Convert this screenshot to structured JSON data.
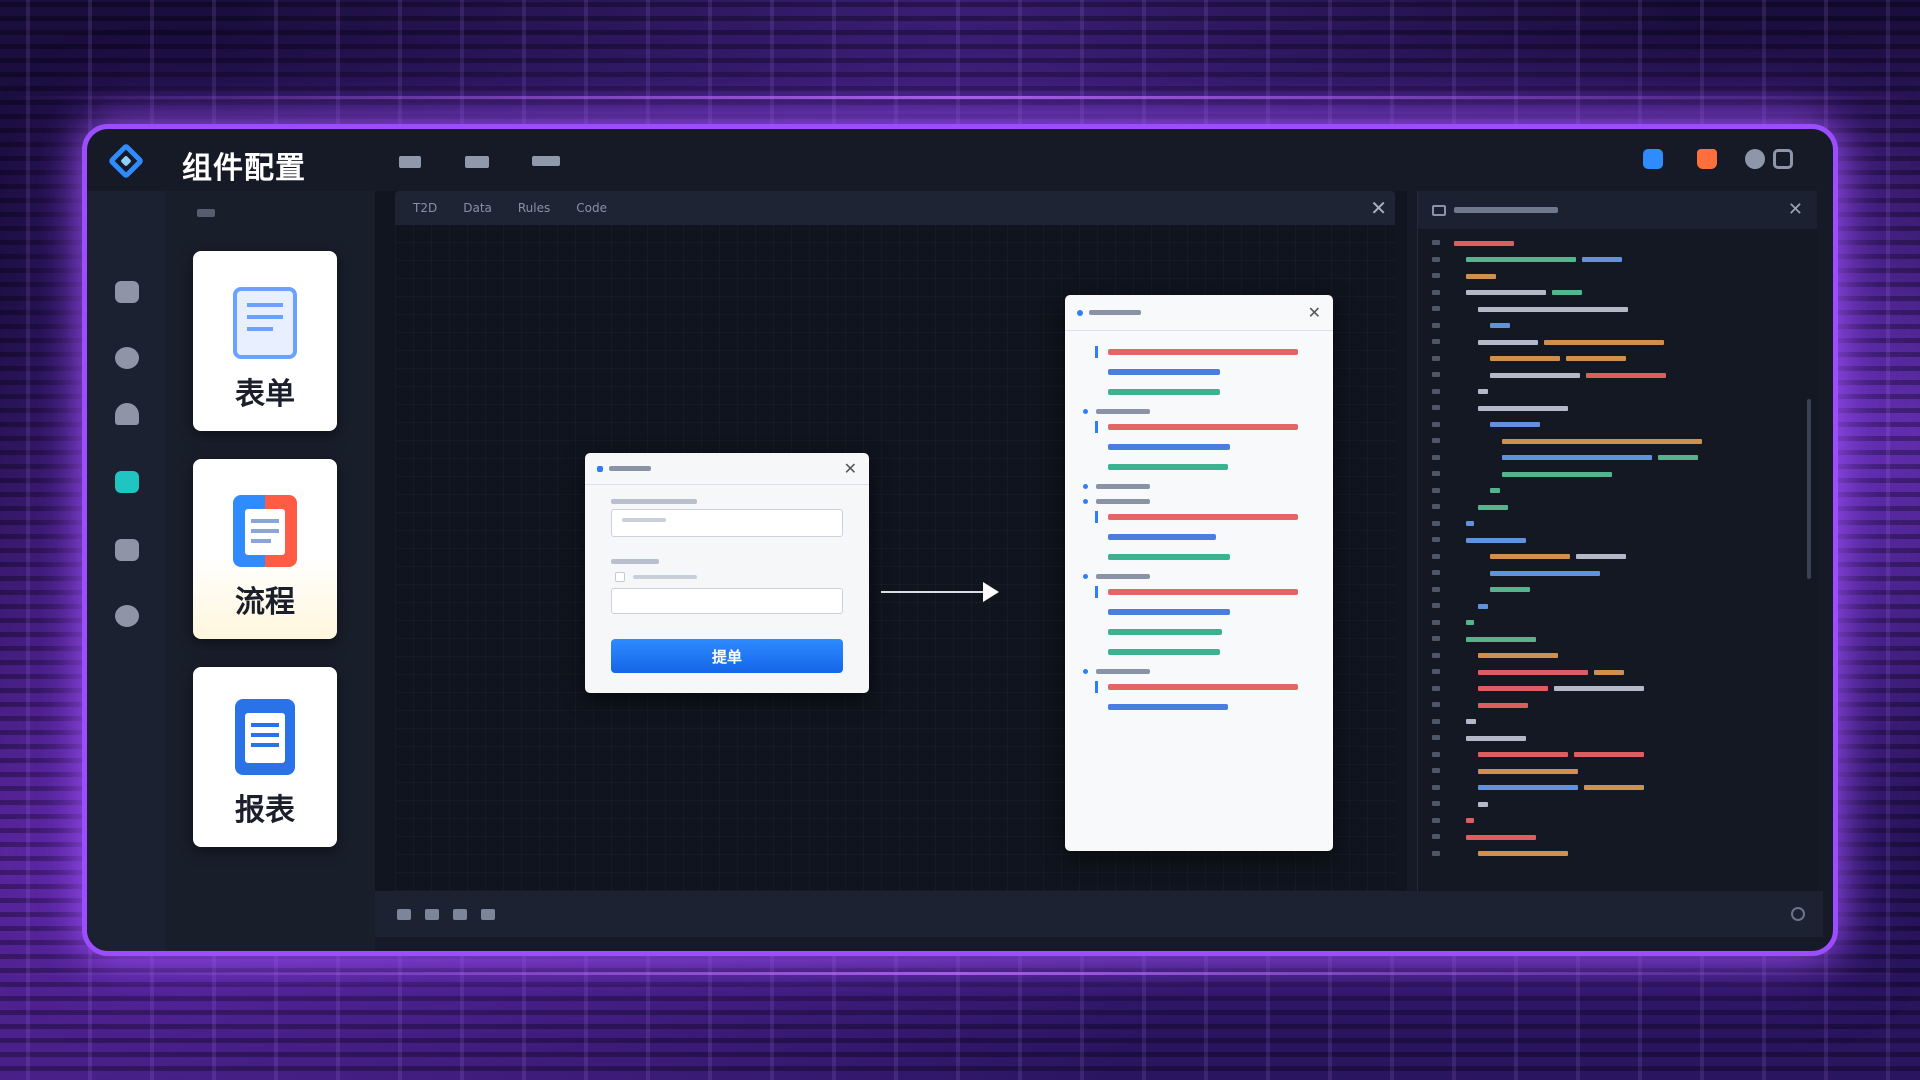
{
  "window": {
    "title": "组件配置"
  },
  "palette": {
    "components": [
      {
        "label": "表单",
        "icon": "form-icon"
      },
      {
        "label": "流程",
        "icon": "flow-icon"
      },
      {
        "label": "报表",
        "icon": "report-icon"
      }
    ]
  },
  "canvas": {
    "tabs": [
      "T2D",
      "Data",
      "Rules",
      "Code"
    ]
  },
  "form_dialog": {
    "submit_label": "提单"
  },
  "rules_panel": {
    "sections": 5
  },
  "colors": {
    "accent": "#2d7ff9",
    "frame_glow": "#9b4dff",
    "active_rail": "#20c5c2",
    "rule_red": "#e14b4b",
    "rule_blue": "#2c69d8",
    "rule_green": "#1ba67a"
  },
  "icons": {
    "logo": "diamond-logo-icon",
    "rail": [
      "database-icon",
      "shield-icon",
      "home-icon",
      "chat-icon",
      "folder-icon",
      "settings-icon"
    ],
    "top_right": [
      "user-icon",
      "lock-icon",
      "list-icon",
      "link-icon"
    ]
  }
}
